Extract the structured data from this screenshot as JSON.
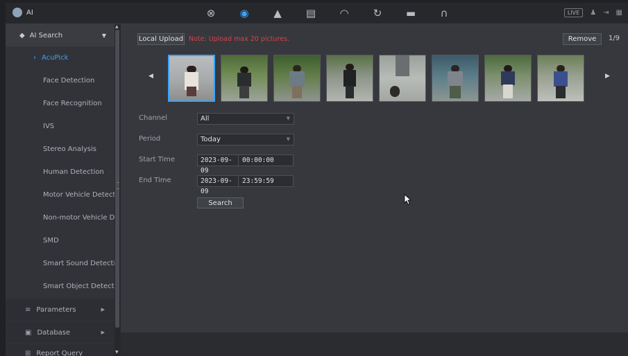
{
  "app": {
    "title": "AI",
    "icon": "ai-head-icon"
  },
  "topnav": {
    "items": [
      {
        "name": "playback-icon",
        "glyph": "⊗"
      },
      {
        "name": "ai-head-icon",
        "glyph": "◉",
        "active": true
      },
      {
        "name": "alarm-bell-icon",
        "glyph": "▲"
      },
      {
        "name": "storage-icon",
        "glyph": "▤"
      },
      {
        "name": "gauge-icon",
        "glyph": "◠"
      },
      {
        "name": "sync-icon",
        "glyph": "↻"
      },
      {
        "name": "monitor-icon",
        "glyph": "▬"
      },
      {
        "name": "headset-icon",
        "glyph": "∩"
      }
    ],
    "live_label": "LIVE",
    "right_icons": [
      "user-icon",
      "logout-icon",
      "menu-icon"
    ]
  },
  "sidebar": {
    "header": {
      "label": "AI Search",
      "icon": "ai-search-icon"
    },
    "items": [
      {
        "label": "AcuPick",
        "active": true
      },
      {
        "label": "Face Detection"
      },
      {
        "label": "Face Recognition"
      },
      {
        "label": "IVS"
      },
      {
        "label": "Stereo Analysis"
      },
      {
        "label": "Human Detection"
      },
      {
        "label": "Motor Vehicle Detection"
      },
      {
        "label": "Non-motor Vehicle Detection"
      },
      {
        "label": "SMD"
      },
      {
        "label": "Smart Sound Detection"
      },
      {
        "label": "Smart Object Detection"
      }
    ],
    "groups": [
      {
        "label": "Parameters",
        "icon": "list-icon"
      },
      {
        "label": "Database",
        "icon": "database-icon"
      },
      {
        "label": "Report Query",
        "icon": "report-icon"
      }
    ]
  },
  "main": {
    "upload_label": "Local Upload",
    "note": "Note: Upload max 20 pictures.",
    "remove_label": "Remove",
    "page_indicator": "1/9",
    "thumbnails_count": 8,
    "form": {
      "channel_label": "Channel",
      "channel_value": "All",
      "period_label": "Period",
      "period_value": "Today",
      "start_label": "Start Time",
      "start_date": "2023-09-09",
      "start_time": "00:00:00",
      "end_label": "End Time",
      "end_date": "2023-09-09",
      "end_time": "23:59:59",
      "search_label": "Search"
    }
  },
  "colors": {
    "accent": "#3aa2ff",
    "note": "#d3444a",
    "bg": "#36383d",
    "sidebar": "#313338"
  }
}
